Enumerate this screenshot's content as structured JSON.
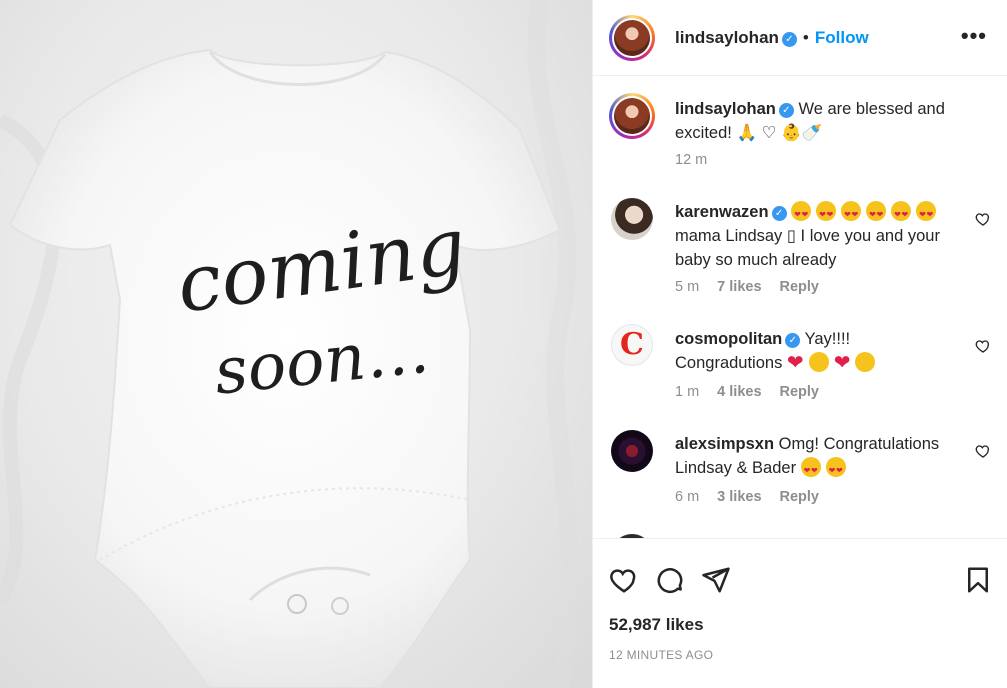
{
  "post": {
    "author": "lindsaylohan",
    "follow_label": "Follow",
    "separator": "•",
    "more_label": "•••",
    "image_text_line1": "coming",
    "image_text_line2": "soon…"
  },
  "caption": {
    "username": "lindsaylohan",
    "text_part1": "We are blessed and",
    "text_part2": "excited! 🙏 ♡ 👶🍼",
    "age": "12 m"
  },
  "comments": [
    {
      "username": "karenwazen",
      "verified": true,
      "line1": "",
      "line2": "mama Lindsay ▯ I love you and your",
      "line3": "baby so much already",
      "age": "5 m",
      "likes": "7 likes",
      "reply": "Reply"
    },
    {
      "username": "cosmopolitan",
      "verified": true,
      "line1": "Yay!!!!",
      "line2": "Congradutions",
      "age": "1 m",
      "likes": "4 likes",
      "reply": "Reply"
    },
    {
      "username": "alexsimpsxn",
      "verified": false,
      "line1": "Omg! Congratulations",
      "line2": "Lindsay & Bader",
      "age": "6 m",
      "likes": "3 likes",
      "reply": "Reply"
    }
  ],
  "footer": {
    "likes": "52,987 likes",
    "timestamp": "12 MINUTES AGO"
  },
  "icons": {
    "like": "heart-icon",
    "comment": "comment-icon",
    "share": "send-icon",
    "save": "bookmark-icon",
    "verified": "verified-badge-icon"
  },
  "colors": {
    "link": "#0095f6",
    "muted": "#8e8e8e",
    "verified": "#3897f0",
    "text": "#262626"
  }
}
